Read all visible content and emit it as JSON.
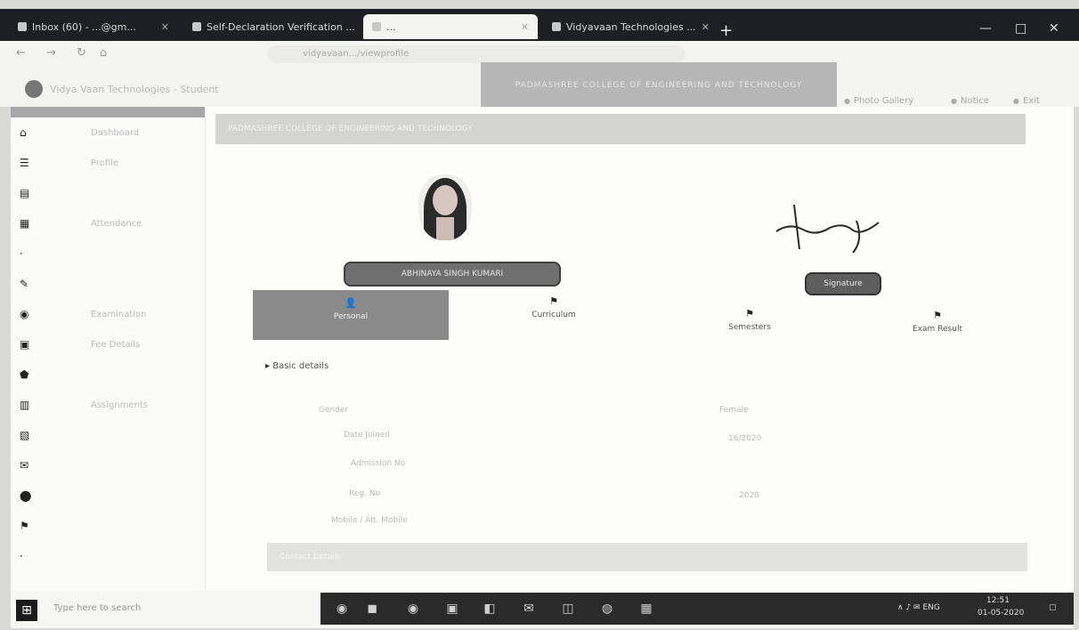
{
  "browser": {
    "tabs": [
      {
        "label": "Inbox (60) - ...@gm...",
        "active": false
      },
      {
        "label": "Self-Declaration Verification ...",
        "active": false
      },
      {
        "label": "...",
        "active": true
      },
      {
        "label": "Vidyavaan Technologies ...",
        "active": false
      }
    ],
    "new_tab_label": "+",
    "window_controls": [
      "—",
      "□",
      "✕"
    ],
    "url": "vidyavaan.../viewprofile",
    "nav_icons": [
      "←",
      "→",
      "↻",
      "⌂"
    ]
  },
  "bookmarks": {
    "site_name": "Vidya Vaan Technologies - Student",
    "items": [
      "Photo Gallery",
      "Notice",
      "Exit"
    ]
  },
  "banner": {
    "title": "PADMASHREE COLLEGE OF ENGINEERING AND TECHNOLOGY"
  },
  "sidebar": {
    "items": [
      {
        "icon": "⌂",
        "label": "Dashboard"
      },
      {
        "icon": "☰",
        "label": "Profile"
      },
      {
        "icon": "▤",
        "label": ""
      },
      {
        "icon": "▦",
        "label": "Attendance"
      },
      {
        "icon": "·",
        "label": ""
      },
      {
        "icon": "✎",
        "label": ""
      },
      {
        "icon": "◉",
        "label": "Examination"
      },
      {
        "icon": "▣",
        "label": "Fee Details"
      },
      {
        "icon": "⬟",
        "label": ""
      },
      {
        "icon": "▥",
        "label": "Assignments"
      },
      {
        "icon": "▧",
        "label": ""
      },
      {
        "icon": "✉",
        "label": ""
      },
      {
        "icon": "⬤",
        "label": ""
      },
      {
        "icon": "⚑",
        "label": ""
      },
      {
        "icon": "·",
        "label": ""
      }
    ]
  },
  "main": {
    "header_title": "PADMASHREE COLLEGE OF ENGINEERING AND TECHNOLOGY",
    "student_name": "ABHINAYA SINGH KUMARI",
    "signature_label": "Signature",
    "tabs": [
      {
        "icon": "👤",
        "label": "Personal"
      },
      {
        "icon": "⚑",
        "label": "Curriculum"
      },
      {
        "icon": "⚑",
        "label": "Semesters"
      },
      {
        "icon": "⚑",
        "label": "Exam Result"
      }
    ],
    "section_label": "Basic details",
    "fields": [
      {
        "label": "Gender",
        "value": "Female"
      },
      {
        "label": "Date Joined",
        "value": "16/2020"
      },
      {
        "label": "Admission No",
        "value": ""
      },
      {
        "label": "Reg. No",
        "value": "2020"
      },
      {
        "label": "Mobile / Alt. Mobile",
        "value": ""
      }
    ],
    "footer_label": "Contact Details"
  },
  "taskbar": {
    "start_icon": "⊞",
    "search_placeholder": "Type here to search",
    "apps": [
      "◉",
      "◼",
      "◉",
      "▣",
      "◧",
      "✉",
      "◫",
      "◍",
      "▦"
    ],
    "tray": "∧ ♪ ✉ ENG",
    "clock_time": "12:51",
    "clock_date": "01-05-2020"
  }
}
